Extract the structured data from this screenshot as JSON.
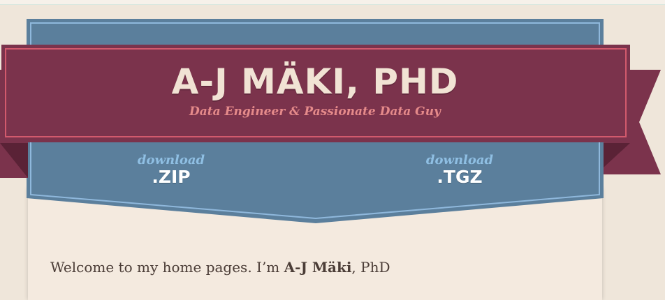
{
  "header": {
    "title": "A-J MÄKI, PHD",
    "tagline": "Data Engineer & Passionate Data Guy"
  },
  "downloads": [
    {
      "word": "download",
      "ext": ".ZIP"
    },
    {
      "word": "download",
      "ext": ".TGZ"
    }
  ],
  "main": {
    "welcome_prefix": "Welcome to my home pages. I’m ",
    "welcome_name": "A-J Mäki",
    "welcome_suffix": ", PhD"
  },
  "colors": {
    "ribbon": "#7b334c",
    "ribbon_dark": "#5a2236",
    "ribbon_border": "#d25a6d",
    "banner": "#5b7f9c",
    "banner_border": "#8fb8dc",
    "page_bg": "#efe6da"
  }
}
